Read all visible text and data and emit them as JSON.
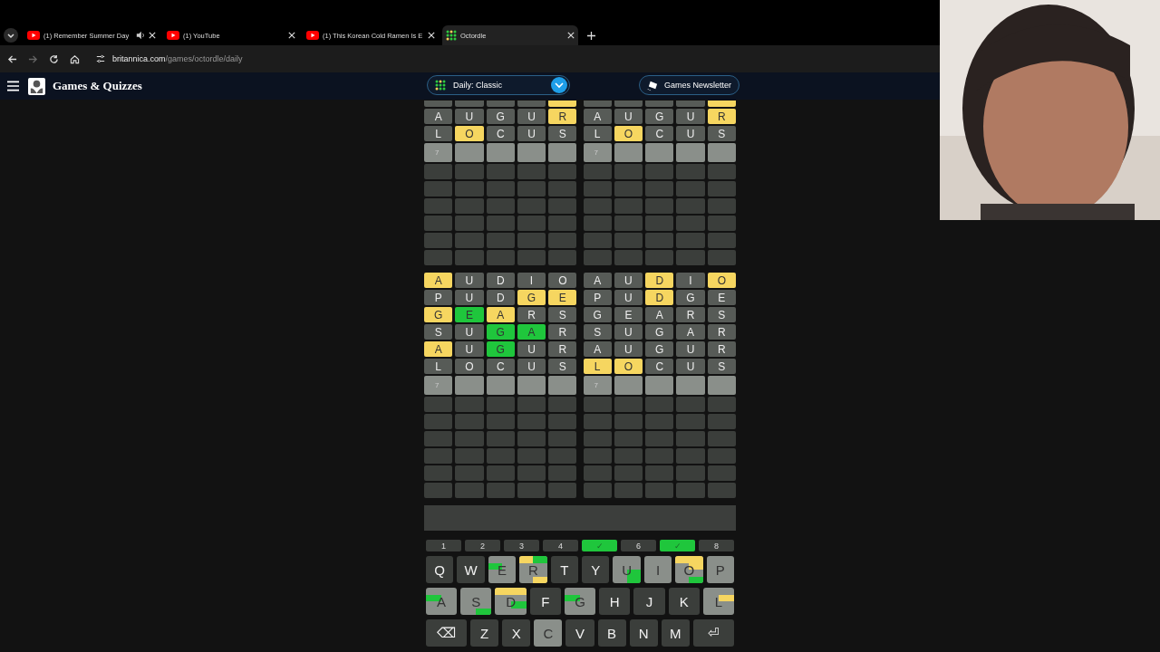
{
  "browser": {
    "tabs": [
      {
        "title": "(1) Remember Summer Day",
        "kind": "video",
        "audio": true,
        "selected": false
      },
      {
        "title": "(1) YouTube",
        "kind": "video",
        "audio": false,
        "selected": false
      },
      {
        "title": "(1) This Korean Cold Ramen Is E",
        "kind": "video",
        "audio": false,
        "selected": false
      },
      {
        "title": "Octordle",
        "kind": "grid",
        "audio": false,
        "selected": true
      }
    ],
    "forward_disabled": true,
    "url": {
      "host": "britannica.com",
      "path": "/games/octordle/daily"
    }
  },
  "header": {
    "title": "Games & Quizzes",
    "mode": "Daily: Classic",
    "newsletter": "Games Newsletter"
  },
  "boards": [
    {
      "rows": [
        {
          "kind": "cut",
          "tiles": [
            {
              "kind": "absent"
            },
            {
              "kind": "absent"
            },
            {
              "kind": "absent"
            },
            {
              "kind": "absent"
            },
            {
              "kind": "present"
            }
          ]
        },
        {
          "kind": "guess",
          "tiles": [
            {
              "letter": "A",
              "kind": "absent"
            },
            {
              "letter": "U",
              "kind": "absent"
            },
            {
              "letter": "G",
              "kind": "absent"
            },
            {
              "letter": "U",
              "kind": "absent"
            },
            {
              "letter": "R",
              "kind": "present"
            }
          ]
        },
        {
          "kind": "guess",
          "tiles": [
            {
              "letter": "L",
              "kind": "absent"
            },
            {
              "letter": "O",
              "kind": "present"
            },
            {
              "letter": "C",
              "kind": "absent"
            },
            {
              "letter": "U",
              "kind": "absent"
            },
            {
              "letter": "S",
              "kind": "absent"
            }
          ]
        },
        {
          "kind": "input",
          "number": "7"
        },
        {
          "kind": "empty"
        },
        {
          "kind": "empty"
        },
        {
          "kind": "empty"
        },
        {
          "kind": "empty"
        },
        {
          "kind": "empty"
        },
        {
          "kind": "empty"
        }
      ]
    },
    {
      "rows": [
        {
          "kind": "cut",
          "tiles": [
            {
              "kind": "absent"
            },
            {
              "kind": "absent"
            },
            {
              "kind": "absent"
            },
            {
              "kind": "absent"
            },
            {
              "kind": "present"
            }
          ]
        },
        {
          "kind": "guess",
          "tiles": [
            {
              "letter": "A",
              "kind": "absent"
            },
            {
              "letter": "U",
              "kind": "absent"
            },
            {
              "letter": "G",
              "kind": "absent"
            },
            {
              "letter": "U",
              "kind": "absent"
            },
            {
              "letter": "R",
              "kind": "present"
            }
          ]
        },
        {
          "kind": "guess",
          "tiles": [
            {
              "letter": "L",
              "kind": "absent"
            },
            {
              "letter": "O",
              "kind": "present"
            },
            {
              "letter": "C",
              "kind": "absent"
            },
            {
              "letter": "U",
              "kind": "absent"
            },
            {
              "letter": "S",
              "kind": "absent"
            }
          ]
        },
        {
          "kind": "input",
          "number": "7"
        },
        {
          "kind": "empty"
        },
        {
          "kind": "empty"
        },
        {
          "kind": "empty"
        },
        {
          "kind": "empty"
        },
        {
          "kind": "empty"
        },
        {
          "kind": "empty"
        }
      ]
    },
    {
      "rows": [
        {
          "kind": "guess",
          "tiles": [
            {
              "letter": "A",
              "kind": "present"
            },
            {
              "letter": "U",
              "kind": "absent"
            },
            {
              "letter": "D",
              "kind": "absent"
            },
            {
              "letter": "I",
              "kind": "absent"
            },
            {
              "letter": "O",
              "kind": "absent"
            }
          ]
        },
        {
          "kind": "guess",
          "tiles": [
            {
              "letter": "P",
              "kind": "absent"
            },
            {
              "letter": "U",
              "kind": "absent"
            },
            {
              "letter": "D",
              "kind": "absent"
            },
            {
              "letter": "G",
              "kind": "present"
            },
            {
              "letter": "E",
              "kind": "present"
            }
          ]
        },
        {
          "kind": "guess",
          "tiles": [
            {
              "letter": "G",
              "kind": "present"
            },
            {
              "letter": "E",
              "kind": "correct"
            },
            {
              "letter": "A",
              "kind": "present"
            },
            {
              "letter": "R",
              "kind": "absent"
            },
            {
              "letter": "S",
              "kind": "absent"
            }
          ]
        },
        {
          "kind": "guess",
          "tiles": [
            {
              "letter": "S",
              "kind": "absent"
            },
            {
              "letter": "U",
              "kind": "absent"
            },
            {
              "letter": "G",
              "kind": "correct"
            },
            {
              "letter": "A",
              "kind": "correct"
            },
            {
              "letter": "R",
              "kind": "absent"
            }
          ]
        },
        {
          "kind": "guess",
          "tiles": [
            {
              "letter": "A",
              "kind": "present"
            },
            {
              "letter": "U",
              "kind": "absent"
            },
            {
              "letter": "G",
              "kind": "correct"
            },
            {
              "letter": "U",
              "kind": "absent"
            },
            {
              "letter": "R",
              "kind": "absent"
            }
          ]
        },
        {
          "kind": "guess",
          "tiles": [
            {
              "letter": "L",
              "kind": "absent"
            },
            {
              "letter": "O",
              "kind": "absent"
            },
            {
              "letter": "C",
              "kind": "absent"
            },
            {
              "letter": "U",
              "kind": "absent"
            },
            {
              "letter": "S",
              "kind": "absent"
            }
          ]
        },
        {
          "kind": "input",
          "number": "7"
        },
        {
          "kind": "empty"
        },
        {
          "kind": "empty"
        },
        {
          "kind": "empty"
        },
        {
          "kind": "empty"
        },
        {
          "kind": "empty"
        },
        {
          "kind": "empty"
        }
      ]
    },
    {
      "rows": [
        {
          "kind": "guess",
          "tiles": [
            {
              "letter": "A",
              "kind": "absent"
            },
            {
              "letter": "U",
              "kind": "absent"
            },
            {
              "letter": "D",
              "kind": "present"
            },
            {
              "letter": "I",
              "kind": "absent"
            },
            {
              "letter": "O",
              "kind": "present"
            }
          ]
        },
        {
          "kind": "guess",
          "tiles": [
            {
              "letter": "P",
              "kind": "absent"
            },
            {
              "letter": "U",
              "kind": "absent"
            },
            {
              "letter": "D",
              "kind": "present"
            },
            {
              "letter": "G",
              "kind": "absent"
            },
            {
              "letter": "E",
              "kind": "absent"
            }
          ]
        },
        {
          "kind": "guess",
          "tiles": [
            {
              "letter": "G",
              "kind": "absent"
            },
            {
              "letter": "E",
              "kind": "absent"
            },
            {
              "letter": "A",
              "kind": "absent"
            },
            {
              "letter": "R",
              "kind": "absent"
            },
            {
              "letter": "S",
              "kind": "absent"
            }
          ]
        },
        {
          "kind": "guess",
          "tiles": [
            {
              "letter": "S",
              "kind": "absent"
            },
            {
              "letter": "U",
              "kind": "absent"
            },
            {
              "letter": "G",
              "kind": "absent"
            },
            {
              "letter": "A",
              "kind": "absent"
            },
            {
              "letter": "R",
              "kind": "absent"
            }
          ]
        },
        {
          "kind": "guess",
          "tiles": [
            {
              "letter": "A",
              "kind": "absent"
            },
            {
              "letter": "U",
              "kind": "absent"
            },
            {
              "letter": "G",
              "kind": "absent"
            },
            {
              "letter": "U",
              "kind": "absent"
            },
            {
              "letter": "R",
              "kind": "absent"
            }
          ]
        },
        {
          "kind": "guess",
          "tiles": [
            {
              "letter": "L",
              "kind": "present"
            },
            {
              "letter": "O",
              "kind": "present"
            },
            {
              "letter": "C",
              "kind": "absent"
            },
            {
              "letter": "U",
              "kind": "absent"
            },
            {
              "letter": "S",
              "kind": "absent"
            }
          ]
        },
        {
          "kind": "input",
          "number": "7"
        },
        {
          "kind": "empty"
        },
        {
          "kind": "empty"
        },
        {
          "kind": "empty"
        },
        {
          "kind": "empty"
        },
        {
          "kind": "empty"
        },
        {
          "kind": "empty"
        }
      ]
    }
  ],
  "board_selector": [
    {
      "label": "1",
      "solved": false
    },
    {
      "label": "2",
      "solved": false
    },
    {
      "label": "3",
      "solved": false
    },
    {
      "label": "4",
      "solved": false
    },
    {
      "label": "✓",
      "solved": true
    },
    {
      "label": "6",
      "solved": false
    },
    {
      "label": "✓",
      "solved": true
    },
    {
      "label": "8",
      "solved": false
    }
  ],
  "keyboard": [
    [
      {
        "kind": "letter",
        "label": "Q",
        "used": false
      },
      {
        "kind": "letter",
        "label": "W",
        "used": false
      },
      {
        "kind": "letter",
        "label": "E",
        "used": true,
        "segments": [
          {
            "kind": "plain"
          },
          {
            "kind": "plain"
          },
          {
            "kind": "correct"
          },
          {
            "kind": "plain"
          },
          {
            "kind": "plain"
          },
          {
            "kind": "plain"
          },
          {
            "kind": "plain"
          },
          {
            "kind": "plain"
          }
        ]
      },
      {
        "kind": "letter",
        "label": "R",
        "used": true,
        "segments": [
          {
            "kind": "present"
          },
          {
            "kind": "correct"
          },
          {
            "kind": "plain"
          },
          {
            "kind": "plain"
          },
          {
            "kind": "plain"
          },
          {
            "kind": "plain"
          },
          {
            "kind": "plain"
          },
          {
            "kind": "present"
          }
        ]
      },
      {
        "kind": "letter",
        "label": "T",
        "used": false
      },
      {
        "kind": "letter",
        "label": "Y",
        "used": false
      },
      {
        "kind": "letter",
        "label": "U",
        "used": true,
        "segments": [
          {
            "kind": "plain"
          },
          {
            "kind": "plain"
          },
          {
            "kind": "plain"
          },
          {
            "kind": "plain"
          },
          {
            "kind": "plain"
          },
          {
            "kind": "correct"
          },
          {
            "kind": "plain"
          },
          {
            "kind": "correct"
          }
        ]
      },
      {
        "kind": "letter",
        "label": "I",
        "used": true
      },
      {
        "kind": "letter",
        "label": "O",
        "used": true,
        "segments": [
          {
            "kind": "present"
          },
          {
            "kind": "present"
          },
          {
            "kind": "plain"
          },
          {
            "kind": "present"
          },
          {
            "kind": "plain"
          },
          {
            "kind": "plain"
          },
          {
            "kind": "plain"
          },
          {
            "kind": "correct"
          }
        ]
      },
      {
        "kind": "letter",
        "label": "P",
        "used": true
      }
    ],
    [
      {
        "kind": "letter",
        "label": "A",
        "used": true,
        "segments": [
          {
            "kind": "plain"
          },
          {
            "kind": "plain"
          },
          {
            "kind": "correct"
          },
          {
            "kind": "plain"
          },
          {
            "kind": "plain"
          },
          {
            "kind": "plain"
          },
          {
            "kind": "plain"
          },
          {
            "kind": "plain"
          }
        ]
      },
      {
        "kind": "letter",
        "label": "S",
        "used": true,
        "segments": [
          {
            "kind": "plain"
          },
          {
            "kind": "plain"
          },
          {
            "kind": "plain"
          },
          {
            "kind": "plain"
          },
          {
            "kind": "plain"
          },
          {
            "kind": "plain"
          },
          {
            "kind": "plain"
          },
          {
            "kind": "correct"
          }
        ]
      },
      {
        "kind": "letter",
        "label": "D",
        "used": true,
        "segments": [
          {
            "kind": "present"
          },
          {
            "kind": "present"
          },
          {
            "kind": "plain"
          },
          {
            "kind": "plain"
          },
          {
            "kind": "plain"
          },
          {
            "kind": "correct"
          },
          {
            "kind": "plain"
          },
          {
            "kind": "plain"
          }
        ]
      },
      {
        "kind": "letter",
        "label": "F",
        "used": false
      },
      {
        "kind": "letter",
        "label": "G",
        "used": true,
        "segments": [
          {
            "kind": "plain"
          },
          {
            "kind": "plain"
          },
          {
            "kind": "correct"
          },
          {
            "kind": "plain"
          },
          {
            "kind": "plain"
          },
          {
            "kind": "plain"
          },
          {
            "kind": "plain"
          },
          {
            "kind": "plain"
          }
        ]
      },
      {
        "kind": "letter",
        "label": "H",
        "used": false
      },
      {
        "kind": "letter",
        "label": "J",
        "used": false
      },
      {
        "kind": "letter",
        "label": "K",
        "used": false
      },
      {
        "kind": "letter",
        "label": "L",
        "used": true,
        "segments": [
          {
            "kind": "plain"
          },
          {
            "kind": "plain"
          },
          {
            "kind": "plain"
          },
          {
            "kind": "present"
          },
          {
            "kind": "plain"
          },
          {
            "kind": "plain"
          },
          {
            "kind": "plain"
          },
          {
            "kind": "plain"
          }
        ]
      }
    ],
    [
      {
        "kind": "wide",
        "label": "⌫",
        "used": false
      },
      {
        "kind": "letter",
        "label": "Z",
        "used": false
      },
      {
        "kind": "letter",
        "label": "X",
        "used": false
      },
      {
        "kind": "letter",
        "label": "C",
        "used": true
      },
      {
        "kind": "letter",
        "label": "V",
        "used": false
      },
      {
        "kind": "letter",
        "label": "B",
        "used": false
      },
      {
        "kind": "letter",
        "label": "N",
        "used": false
      },
      {
        "kind": "letter",
        "label": "M",
        "used": false
      },
      {
        "kind": "wide",
        "label": "⏎",
        "used": false
      }
    ]
  ]
}
